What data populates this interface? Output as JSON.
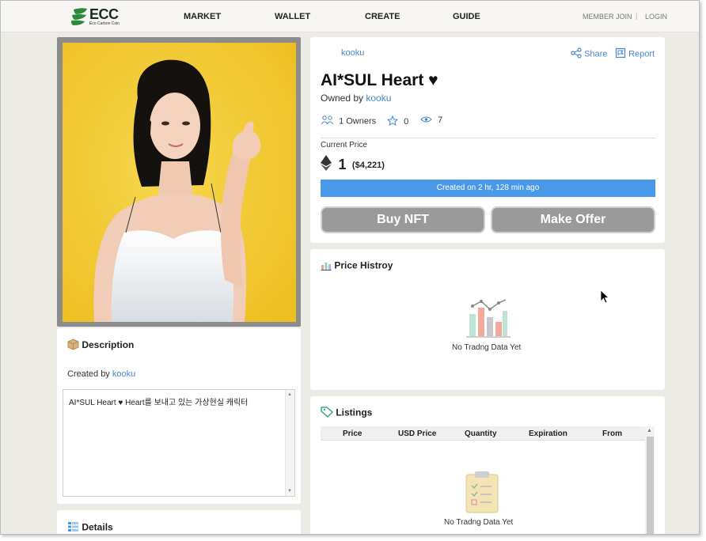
{
  "nav": {
    "logo_name": "ECC",
    "logo_sub": "Eco Carbon Coin",
    "items": [
      "MARKET",
      "WALLET",
      "CREATE",
      "GUIDE"
    ],
    "member_join": "MEMBER JOIN",
    "separator": "|",
    "login": "LOGIN"
  },
  "item": {
    "creator": "kooku",
    "share": "Share",
    "report": "Report",
    "title": "AI*SUL Heart ♥",
    "owned_by_label": "Owned by",
    "owner": "kooku",
    "owners_count": "1 Owners",
    "favorites": "0",
    "views": "7",
    "current_price_label": "Current Price",
    "price": "1",
    "price_usd": "($4,221)",
    "created_status": "Created on 2 hr, 128 min ago",
    "buy_label": "Buy NFT",
    "offer_label": "Make Offer"
  },
  "price_history": {
    "title": "Price Histroy",
    "empty": "No Tradng Data Yet"
  },
  "listings": {
    "title": "Listings",
    "columns": [
      "Price",
      "USD Price",
      "Quantity",
      "Expiration",
      "From"
    ],
    "empty": "No Tradng Data Yet"
  },
  "description": {
    "title": "Description",
    "created_by_label": "Created by",
    "creator": "kooku",
    "text": "AI*SUL Heart ♥ Heart를 보내고 있는 가상현실 캐릭터"
  },
  "details": {
    "title": "Details"
  },
  "colors": {
    "accent_blue": "#4a98e8",
    "link_blue": "#4a86c8",
    "logo_green": "#2e8b3e",
    "nft_background": "#f1c832",
    "button_gray": "#9a9a9a"
  }
}
